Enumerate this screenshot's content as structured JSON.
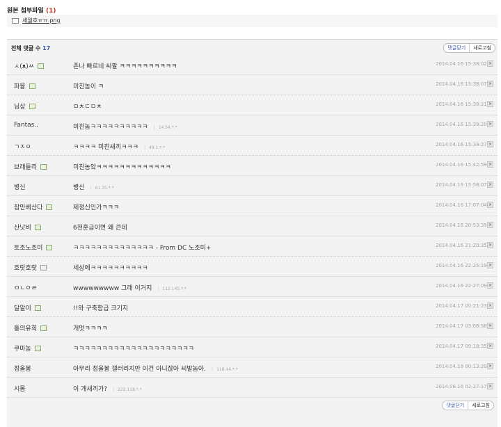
{
  "attachments": {
    "title": "원본 첨부파일",
    "count": "(1)",
    "files": [
      {
        "name": "세월호ㅠㅠ.png",
        "icon": "image-file-icon"
      }
    ]
  },
  "comments_header": {
    "label": "전체 댓글 수",
    "count": "17",
    "fold_label": "댓글닫기",
    "refresh_label": "새로고침"
  },
  "comments": [
    {
      "nick": "ㅅ(ᴥ)ㅆ",
      "badge": "green",
      "text": "존나 빠르네 씨팔 ㅋㅋㅋㅋㅋㅋㅋㅋㅋㅋ",
      "ip": "",
      "date": "2014.04.16 15:38:02"
    },
    {
      "nick": "파뮹",
      "badge": "green",
      "text": "미친놈이 ㅋ",
      "ip": "",
      "date": "2014.04.16 15:38:07"
    },
    {
      "nick": "님상",
      "badge": "green",
      "text": "ㅁㅊㄷㅁㅊ",
      "ip": "",
      "date": "2014.04.16 15:38:21"
    },
    {
      "nick": "Fantas..",
      "badge": "",
      "text": "미친놈ㅋㅋㅋㅋㅋㅋㅋㅋㅋㅋ",
      "ip": "14.54.*.*",
      "date": "2014.04.16 15:39:20"
    },
    {
      "nick": "ㄱㅈㅇ",
      "badge": "",
      "text": "ㅋㅋㅋㅋ 미친새끼ㅋㅋㅋ",
      "ip": "49.1.*.*",
      "date": "2014.04.16 15:39:27"
    },
    {
      "nick": "브래들리",
      "badge": "green",
      "text": "미친놈앜ㅋㅋㅋㅋㅋㅋㅋㅋㅋㅋㅋㅋㅋ",
      "ip": "",
      "date": "2014.04.16 15:42:59"
    },
    {
      "nick": "병신",
      "badge": "",
      "text": "병신",
      "ip": "61.35.*.*",
      "date": "2014.04.16 15:58:07"
    },
    {
      "nick": "잠만베산다",
      "badge": "green",
      "text": "제정신인가ㅋㅋㅋ",
      "ip": "",
      "date": "2014.04.16 17:07:04"
    },
    {
      "nick": "산낫비",
      "badge": "green",
      "text": "6천훈금이면 왜 큰데",
      "ip": "",
      "date": "2014.04.16 20:53:35"
    },
    {
      "nick": "토조노조미",
      "badge": "green",
      "text": "ㅋㅋㅋㅋㅋㅋㅋㅋㅋㅋㅋㅋㅋㅋ - From DC 노조미+",
      "ip": "",
      "date": "2014.04.16 21:20:35"
    },
    {
      "nick": "호랏호랏",
      "badge": "gray",
      "text": "세상에ㅋㅋㅋㅋㅋㅋㅋㅋㅋㅋ",
      "ip": "",
      "date": "2014.04.16 22:25:19"
    },
    {
      "nick": "ㅁㄴㅇㄹ",
      "badge": "",
      "text": "wwwwwwwww 그래 이거지",
      "ip": "112.145.*.*",
      "date": "2014.04.16 22:27:09"
    },
    {
      "nick": "달알이",
      "badge": "green",
      "text": "!!와 구축함급 크기지",
      "ip": "",
      "date": "2014.04.17 00:21:23"
    },
    {
      "nick": "통의유희",
      "badge": "green",
      "text": "개멋ㅋㅋㅋㅋ",
      "ip": "",
      "date": "2014.04.17 03:08:58"
    },
    {
      "nick": "쿠마농",
      "badge": "green",
      "text": "ㅋㅋㅋㅋㅋㅋㅋㅋㅋㅋㅋㅋㅋㅋㅋㅋㅋㅋㅋㅋㅋ",
      "ip": "",
      "date": "2014.04.17 09:18:35"
    },
    {
      "nick": "정올봉",
      "badge": "",
      "text": "아무리 정올봉 갤러리지만 이건 아니잖아 씨발놈아.",
      "ip": "118.44.*.*",
      "date": "2014.04.18 00:13:29"
    },
    {
      "nick": "시몸",
      "badge": "",
      "text": "이 개새끼가?",
      "ip": "222.118.*.*",
      "date": "2014.08.16 02:27:17"
    }
  ],
  "delete_glyph": "×",
  "colors": {
    "accent_blue": "#3a58a8",
    "count_red": "#c0392b",
    "row_bg": "#f3f3f3"
  }
}
